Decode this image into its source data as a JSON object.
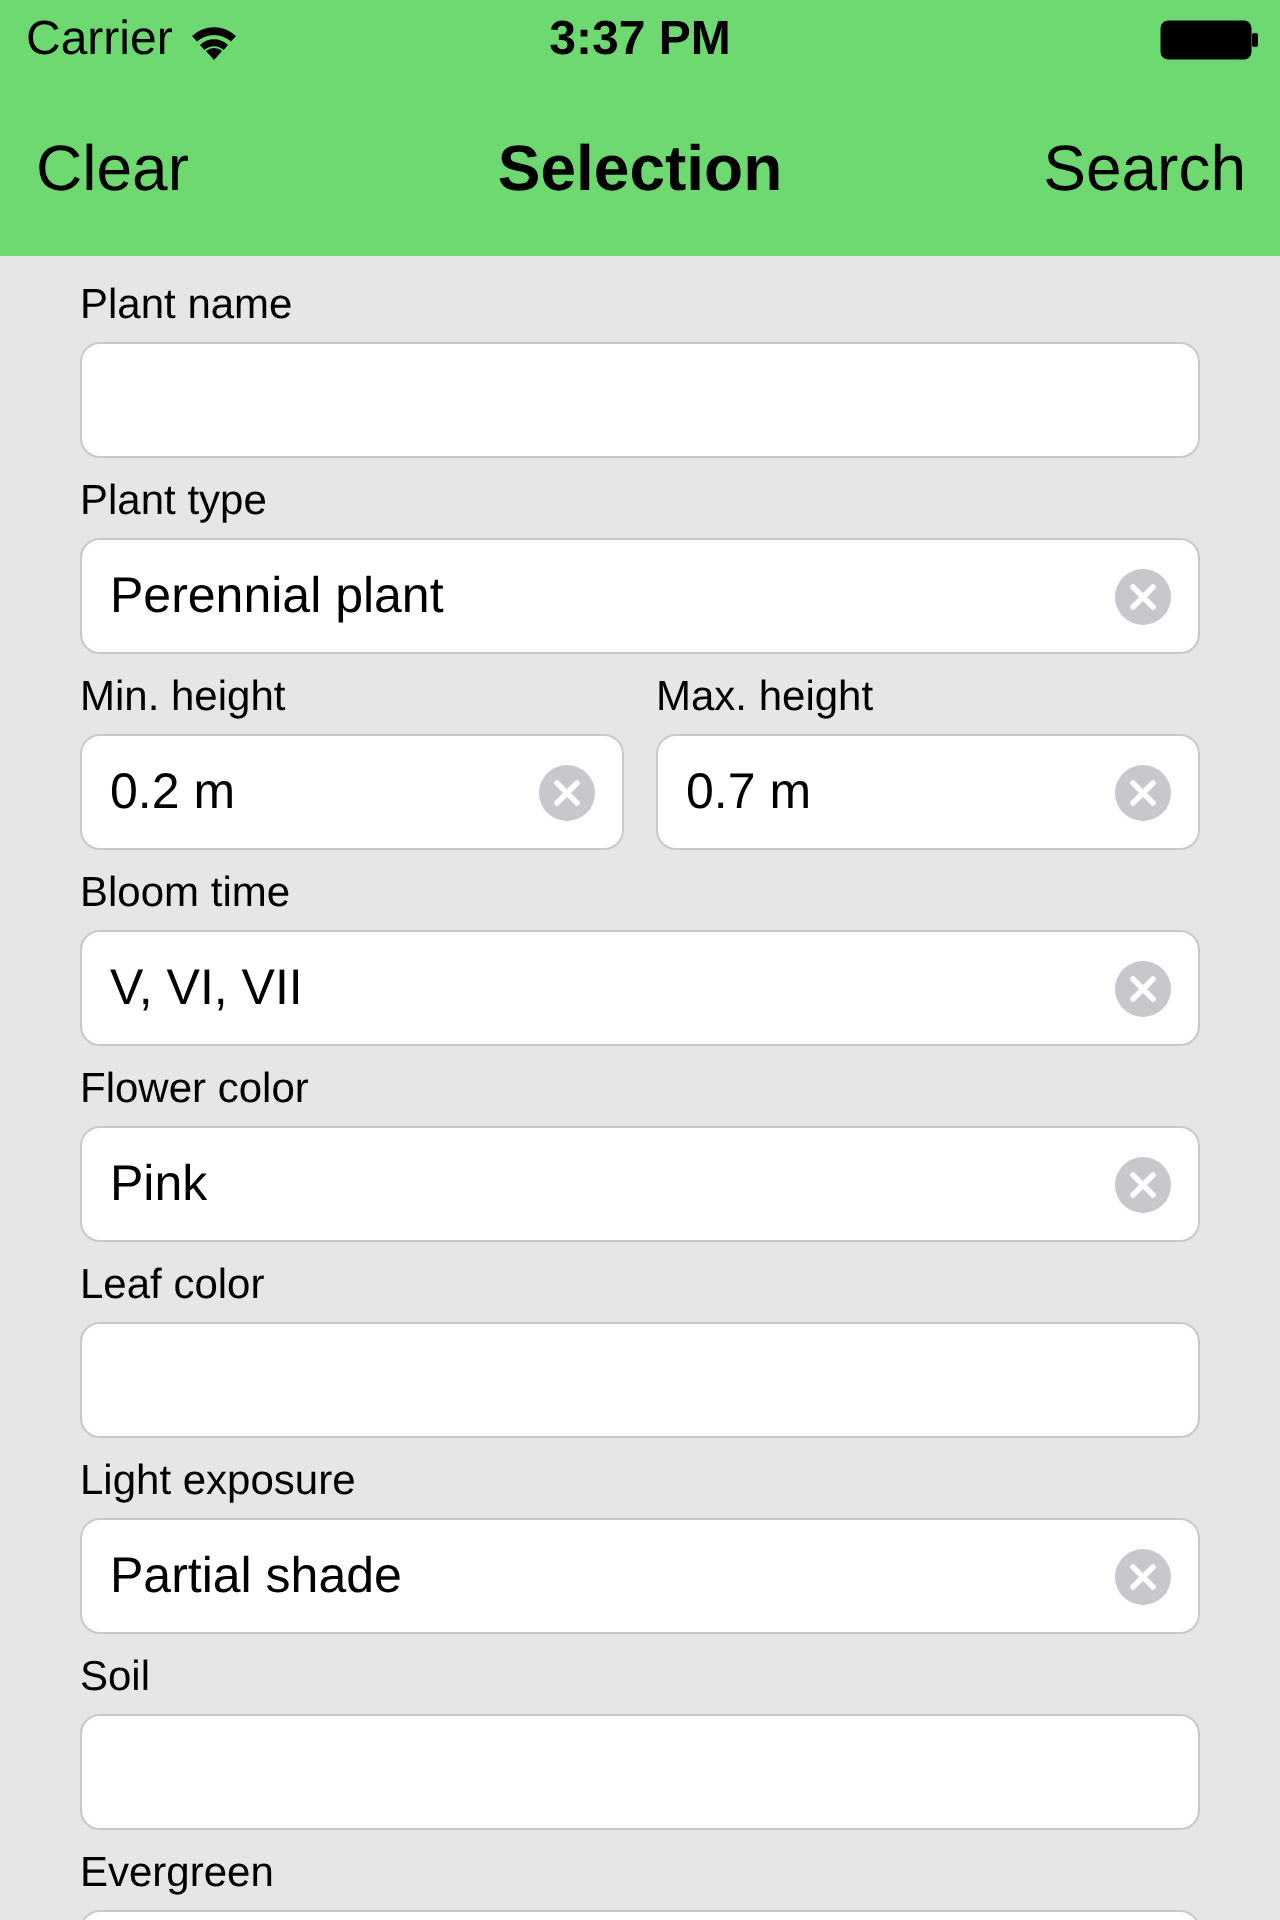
{
  "status_bar": {
    "carrier": "Carrier",
    "time": "3:37 PM"
  },
  "nav_bar": {
    "left": "Clear",
    "title": "Selection",
    "right": "Search"
  },
  "form": [
    {
      "fields": [
        {
          "label": "Plant name"
        }
      ]
    },
    {
      "fields": [
        {
          "label": "Plant type",
          "value": "Perennial plant"
        }
      ]
    },
    {
      "fields": [
        {
          "label": "Min. height",
          "value": "0.2 m"
        },
        {
          "label": "Max. height",
          "value": "0.7 m"
        }
      ]
    },
    {
      "fields": [
        {
          "label": "Bloom time",
          "value": "V, VI, VII"
        }
      ]
    },
    {
      "fields": [
        {
          "label": "Flower color",
          "value": "Pink"
        }
      ]
    },
    {
      "fields": [
        {
          "label": "Leaf color"
        }
      ]
    },
    {
      "fields": [
        {
          "label": "Light exposure",
          "value": "Partial shade"
        }
      ]
    },
    {
      "fields": [
        {
          "label": "Soil"
        }
      ]
    },
    {
      "fields": [
        {
          "label": "Evergreen"
        }
      ]
    }
  ]
}
